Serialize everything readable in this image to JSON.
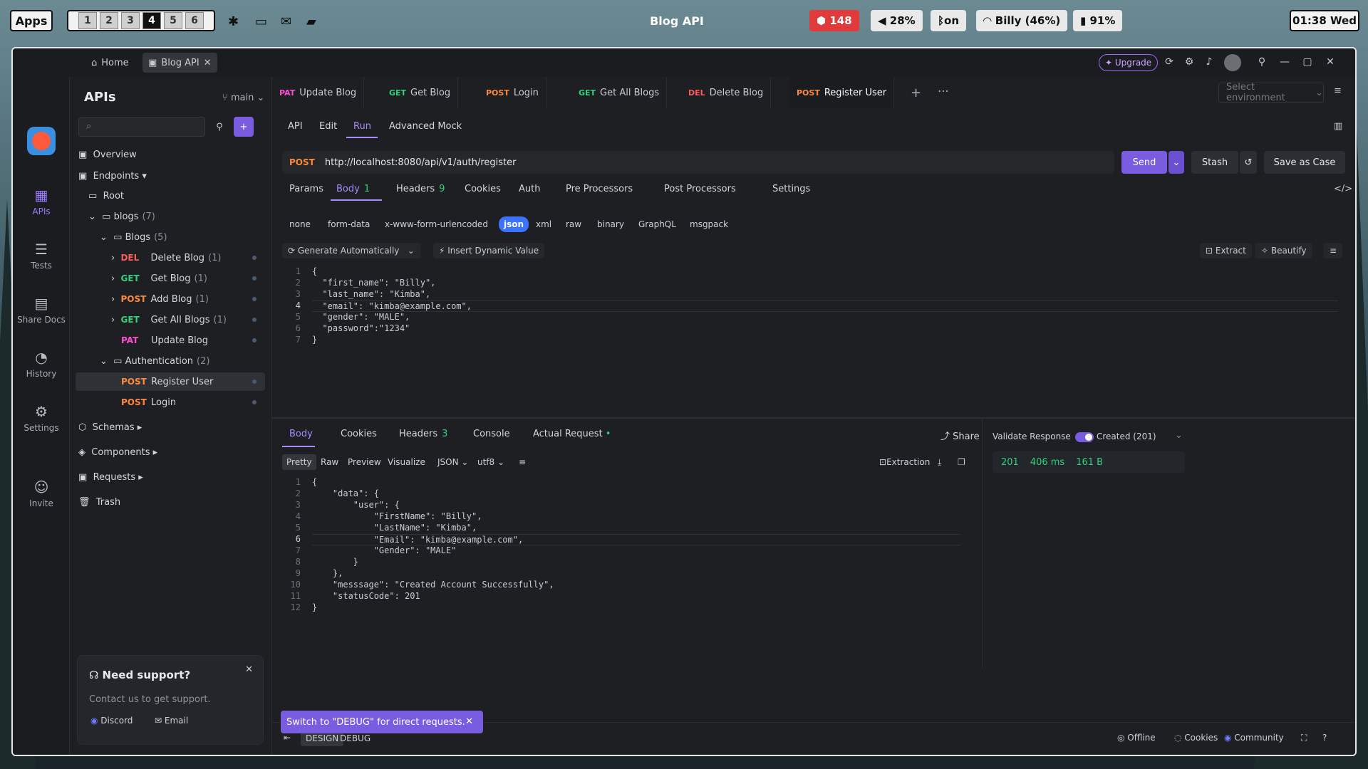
{
  "topbar": {
    "apps": "Apps",
    "workspaces": [
      "1",
      "2",
      "3",
      "4",
      "5",
      "6"
    ],
    "active_workspace": "4",
    "window_title": "Blog API",
    "notifications": "148",
    "volume": "28%",
    "bluetooth": "on",
    "wifi": "Billy (46%)",
    "battery": "91%",
    "clock": "01:38 Wed"
  },
  "titlebar": {
    "tabs": [
      {
        "label": "Home"
      },
      {
        "label": "Blog API"
      }
    ],
    "upgrade": "Upgrade"
  },
  "rail": {
    "items": [
      {
        "label": "APIs",
        "icon": "apis-icon"
      },
      {
        "label": "Tests",
        "icon": "tests-icon"
      },
      {
        "label": "Share Docs",
        "icon": "share-docs-icon"
      },
      {
        "label": "History",
        "icon": "history-icon"
      },
      {
        "label": "Settings",
        "icon": "settings-icon"
      },
      {
        "label": "Invite",
        "icon": "invite-icon"
      }
    ]
  },
  "sidebar": {
    "title": "APIs",
    "branch": "main",
    "overview": "Overview",
    "endpoints": "Endpoints",
    "root": "Root",
    "blogs_folder": {
      "label": "blogs",
      "count": "(7)"
    },
    "blogs_sub": {
      "label": "Blogs",
      "count": "(5)"
    },
    "items": [
      {
        "method": "DEL",
        "label": "Delete Blog",
        "count": "(1)"
      },
      {
        "method": "GET",
        "label": "Get Blog",
        "count": "(1)"
      },
      {
        "method": "POST",
        "label": "Add Blog",
        "count": "(1)"
      },
      {
        "method": "GET",
        "label": "Get All Blogs",
        "count": "(1)"
      },
      {
        "method": "PAT",
        "label": "Update Blog",
        "count": ""
      }
    ],
    "auth_folder": {
      "label": "Authentication",
      "count": "(2)"
    },
    "auth_items": [
      {
        "method": "POST",
        "label": "Register User"
      },
      {
        "method": "POST",
        "label": "Login"
      }
    ],
    "schemas": "Schemas",
    "components": "Components",
    "requests": "Requests",
    "trash": "Trash",
    "support": {
      "title": "Need support?",
      "text": "Contact us to get support.",
      "discord": "Discord",
      "email": "Email"
    }
  },
  "request_tabs": [
    {
      "method": "PAT",
      "label": "Update Blog"
    },
    {
      "method": "GET",
      "label": "Get Blog"
    },
    {
      "method": "POST",
      "label": "Login"
    },
    {
      "method": "GET",
      "label": "Get All Blogs"
    },
    {
      "method": "DEL",
      "label": "Delete Blog"
    },
    {
      "method": "POST",
      "label": "Register User"
    }
  ],
  "env_placeholder": "Select environment",
  "mode_tabs": [
    "API",
    "Edit",
    "Run",
    "Advanced Mock"
  ],
  "url": {
    "method": "POST",
    "value": "http://localhost:8080/api/v1/auth/register"
  },
  "buttons": {
    "send": "Send",
    "stash": "Stash",
    "save_case": "Save as Case"
  },
  "param_tabs": [
    {
      "label": "Params",
      "badge": ""
    },
    {
      "label": "Body",
      "badge": "1"
    },
    {
      "label": "Headers",
      "badge": "9"
    },
    {
      "label": "Cookies",
      "badge": ""
    },
    {
      "label": "Auth",
      "badge": ""
    },
    {
      "label": "Pre Processors",
      "badge": ""
    },
    {
      "label": "Post Processors",
      "badge": ""
    },
    {
      "label": "Settings",
      "badge": ""
    }
  ],
  "body_types": [
    "none",
    "form-data",
    "x-www-form-urlencoded",
    "json",
    "xml",
    "raw",
    "binary",
    "GraphQL",
    "msgpack"
  ],
  "body_tools": {
    "generate": "Generate Automatically",
    "insert": "Insert Dynamic Value",
    "extract": "Extract",
    "beautify": "Beautify"
  },
  "request_body": [
    "{",
    "  \"first_name\": \"Billy\",",
    "  \"last_name\": \"Kimba\",",
    "  \"email\": \"kimba@example.com\",",
    "  \"gender\": \"MALE\",",
    "  \"password\":\"1234\"",
    "}"
  ],
  "response_tabs": [
    {
      "label": "Body",
      "badge": ""
    },
    {
      "label": "Cookies",
      "badge": ""
    },
    {
      "label": "Headers",
      "badge": "3"
    },
    {
      "label": "Console",
      "badge": ""
    },
    {
      "label": "Actual Request",
      "badge": ""
    }
  ],
  "share": "Share",
  "response_formats": [
    "Pretty",
    "Raw",
    "Preview",
    "Visualize",
    "JSON",
    "utf8"
  ],
  "extraction": "Extraction",
  "response_body": [
    "{",
    "    \"data\": {",
    "        \"user\": {",
    "            \"FirstName\": \"Billy\",",
    "            \"LastName\": \"Kimba\",",
    "            \"Email\": \"kimba@example.com\",",
    "            \"Gender\": \"MALE\"",
    "        }",
    "    },",
    "    \"messsage\": \"Created Account Successfully\",",
    "    \"statusCode\": 201",
    "}"
  ],
  "validate": {
    "label": "Validate Response",
    "status": "Created (201)"
  },
  "result": {
    "code": "201",
    "time": "406 ms",
    "size": "161 B"
  },
  "toast": "Switch to \"DEBUG\" for direct requests.",
  "bottom": {
    "design": "DESIGN",
    "debug": "DEBUG",
    "offline": "Offline",
    "cookies": "Cookies",
    "community": "Community"
  }
}
